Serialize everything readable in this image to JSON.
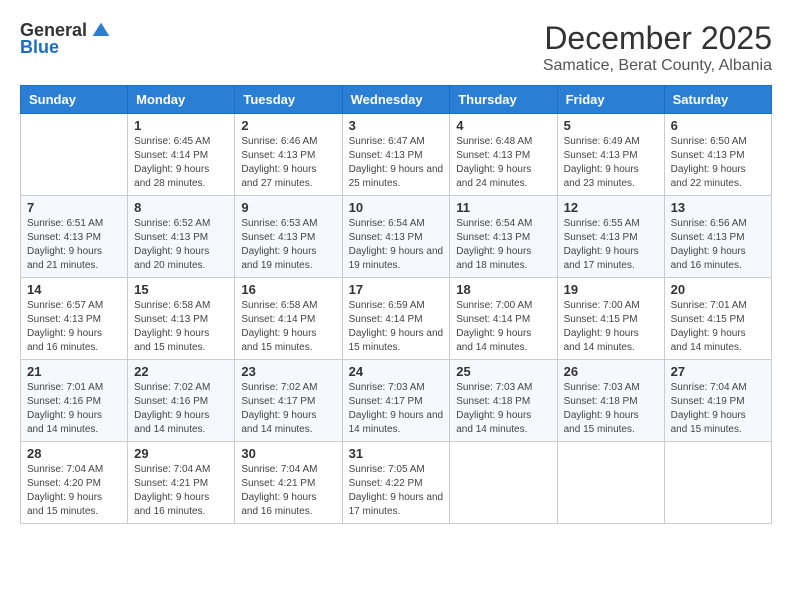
{
  "logo": {
    "general": "General",
    "blue": "Blue"
  },
  "header": {
    "title": "December 2025",
    "subtitle": "Samatice, Berat County, Albania"
  },
  "weekdays": [
    "Sunday",
    "Monday",
    "Tuesday",
    "Wednesday",
    "Thursday",
    "Friday",
    "Saturday"
  ],
  "weeks": [
    [
      {
        "day": "",
        "sunrise": "",
        "sunset": "",
        "daylight": ""
      },
      {
        "day": "1",
        "sunrise": "Sunrise: 6:45 AM",
        "sunset": "Sunset: 4:14 PM",
        "daylight": "Daylight: 9 hours and 28 minutes."
      },
      {
        "day": "2",
        "sunrise": "Sunrise: 6:46 AM",
        "sunset": "Sunset: 4:13 PM",
        "daylight": "Daylight: 9 hours and 27 minutes."
      },
      {
        "day": "3",
        "sunrise": "Sunrise: 6:47 AM",
        "sunset": "Sunset: 4:13 PM",
        "daylight": "Daylight: 9 hours and 25 minutes."
      },
      {
        "day": "4",
        "sunrise": "Sunrise: 6:48 AM",
        "sunset": "Sunset: 4:13 PM",
        "daylight": "Daylight: 9 hours and 24 minutes."
      },
      {
        "day": "5",
        "sunrise": "Sunrise: 6:49 AM",
        "sunset": "Sunset: 4:13 PM",
        "daylight": "Daylight: 9 hours and 23 minutes."
      },
      {
        "day": "6",
        "sunrise": "Sunrise: 6:50 AM",
        "sunset": "Sunset: 4:13 PM",
        "daylight": "Daylight: 9 hours and 22 minutes."
      }
    ],
    [
      {
        "day": "7",
        "sunrise": "Sunrise: 6:51 AM",
        "sunset": "Sunset: 4:13 PM",
        "daylight": "Daylight: 9 hours and 21 minutes."
      },
      {
        "day": "8",
        "sunrise": "Sunrise: 6:52 AM",
        "sunset": "Sunset: 4:13 PM",
        "daylight": "Daylight: 9 hours and 20 minutes."
      },
      {
        "day": "9",
        "sunrise": "Sunrise: 6:53 AM",
        "sunset": "Sunset: 4:13 PM",
        "daylight": "Daylight: 9 hours and 19 minutes."
      },
      {
        "day": "10",
        "sunrise": "Sunrise: 6:54 AM",
        "sunset": "Sunset: 4:13 PM",
        "daylight": "Daylight: 9 hours and 19 minutes."
      },
      {
        "day": "11",
        "sunrise": "Sunrise: 6:54 AM",
        "sunset": "Sunset: 4:13 PM",
        "daylight": "Daylight: 9 hours and 18 minutes."
      },
      {
        "day": "12",
        "sunrise": "Sunrise: 6:55 AM",
        "sunset": "Sunset: 4:13 PM",
        "daylight": "Daylight: 9 hours and 17 minutes."
      },
      {
        "day": "13",
        "sunrise": "Sunrise: 6:56 AM",
        "sunset": "Sunset: 4:13 PM",
        "daylight": "Daylight: 9 hours and 16 minutes."
      }
    ],
    [
      {
        "day": "14",
        "sunrise": "Sunrise: 6:57 AM",
        "sunset": "Sunset: 4:13 PM",
        "daylight": "Daylight: 9 hours and 16 minutes."
      },
      {
        "day": "15",
        "sunrise": "Sunrise: 6:58 AM",
        "sunset": "Sunset: 4:13 PM",
        "daylight": "Daylight: 9 hours and 15 minutes."
      },
      {
        "day": "16",
        "sunrise": "Sunrise: 6:58 AM",
        "sunset": "Sunset: 4:14 PM",
        "daylight": "Daylight: 9 hours and 15 minutes."
      },
      {
        "day": "17",
        "sunrise": "Sunrise: 6:59 AM",
        "sunset": "Sunset: 4:14 PM",
        "daylight": "Daylight: 9 hours and 15 minutes."
      },
      {
        "day": "18",
        "sunrise": "Sunrise: 7:00 AM",
        "sunset": "Sunset: 4:14 PM",
        "daylight": "Daylight: 9 hours and 14 minutes."
      },
      {
        "day": "19",
        "sunrise": "Sunrise: 7:00 AM",
        "sunset": "Sunset: 4:15 PM",
        "daylight": "Daylight: 9 hours and 14 minutes."
      },
      {
        "day": "20",
        "sunrise": "Sunrise: 7:01 AM",
        "sunset": "Sunset: 4:15 PM",
        "daylight": "Daylight: 9 hours and 14 minutes."
      }
    ],
    [
      {
        "day": "21",
        "sunrise": "Sunrise: 7:01 AM",
        "sunset": "Sunset: 4:16 PM",
        "daylight": "Daylight: 9 hours and 14 minutes."
      },
      {
        "day": "22",
        "sunrise": "Sunrise: 7:02 AM",
        "sunset": "Sunset: 4:16 PM",
        "daylight": "Daylight: 9 hours and 14 minutes."
      },
      {
        "day": "23",
        "sunrise": "Sunrise: 7:02 AM",
        "sunset": "Sunset: 4:17 PM",
        "daylight": "Daylight: 9 hours and 14 minutes."
      },
      {
        "day": "24",
        "sunrise": "Sunrise: 7:03 AM",
        "sunset": "Sunset: 4:17 PM",
        "daylight": "Daylight: 9 hours and 14 minutes."
      },
      {
        "day": "25",
        "sunrise": "Sunrise: 7:03 AM",
        "sunset": "Sunset: 4:18 PM",
        "daylight": "Daylight: 9 hours and 14 minutes."
      },
      {
        "day": "26",
        "sunrise": "Sunrise: 7:03 AM",
        "sunset": "Sunset: 4:18 PM",
        "daylight": "Daylight: 9 hours and 15 minutes."
      },
      {
        "day": "27",
        "sunrise": "Sunrise: 7:04 AM",
        "sunset": "Sunset: 4:19 PM",
        "daylight": "Daylight: 9 hours and 15 minutes."
      }
    ],
    [
      {
        "day": "28",
        "sunrise": "Sunrise: 7:04 AM",
        "sunset": "Sunset: 4:20 PM",
        "daylight": "Daylight: 9 hours and 15 minutes."
      },
      {
        "day": "29",
        "sunrise": "Sunrise: 7:04 AM",
        "sunset": "Sunset: 4:21 PM",
        "daylight": "Daylight: 9 hours and 16 minutes."
      },
      {
        "day": "30",
        "sunrise": "Sunrise: 7:04 AM",
        "sunset": "Sunset: 4:21 PM",
        "daylight": "Daylight: 9 hours and 16 minutes."
      },
      {
        "day": "31",
        "sunrise": "Sunrise: 7:05 AM",
        "sunset": "Sunset: 4:22 PM",
        "daylight": "Daylight: 9 hours and 17 minutes."
      },
      {
        "day": "",
        "sunrise": "",
        "sunset": "",
        "daylight": ""
      },
      {
        "day": "",
        "sunrise": "",
        "sunset": "",
        "daylight": ""
      },
      {
        "day": "",
        "sunrise": "",
        "sunset": "",
        "daylight": ""
      }
    ]
  ]
}
